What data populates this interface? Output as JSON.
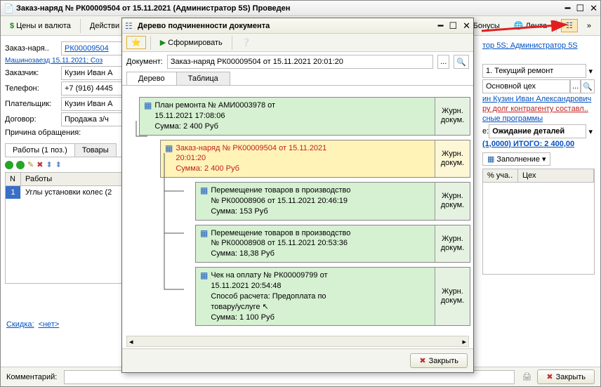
{
  "main_window": {
    "title": "Заказ-наряд № РК00009504 от 15.11.2021 (Администратор 5S) Проведен",
    "toolbar": {
      "prices": "Цены и валюта",
      "actions": "Действи",
      "bonuses": "Бонусы",
      "lenta": "Лента"
    },
    "link_top": "Машинозаезд 15.11.2021; Соз",
    "fields": {
      "order_label": "Заказ-наря..",
      "order_value": "РК00009504",
      "customer_label": "Заказчик:",
      "customer_value": "Кузин Иван А",
      "phone_label": "Телефон:",
      "phone_value": "+7 (916) 4445",
      "payer_label": "Плательщик:",
      "payer_value": "Кузин Иван А",
      "contract_label": "Договор:",
      "contract_value": "Продажа з/ч",
      "reason_label": "Причина обращения:"
    },
    "tabs": {
      "works": "Работы (1 поз.)",
      "goods": "Товары"
    },
    "table": {
      "col_n": "N",
      "col_work": "Работы",
      "row_n": "1",
      "row_work": "Углы установки колес (2"
    },
    "discount": {
      "label": "Скидка:",
      "value": "<нет>"
    },
    "comment_label": "Комментарий:",
    "close_btn": "Закрыть",
    "right": {
      "admin": "тор 5S; Администратор 5S",
      "repair_type": "1. Текущий ремонт",
      "workshop": "Основной цех",
      "owner": "ин Кузин Иван Александрович",
      "debt": "ру долг контрагенту составл..",
      "programs": "сные программы",
      "state_lbl": "е:",
      "state": "Ожидание деталей",
      "total": "(1,0000) ИТОГО: 2 400,00",
      "fill_btn": "Заполнение",
      "col_pct": "% уча..",
      "col_shop": "Цех"
    }
  },
  "modal": {
    "title": "Дерево подчиненности документа",
    "form_btn": "Сформировать",
    "doc_label": "Документ:",
    "doc_value": "Заказ-наряд РК00009504 от 15.11.2021 20:01:20",
    "tab_tree": "Дерево",
    "tab_table": "Таблица",
    "journ": "Журн. докум.",
    "close_btn": "Закрыть",
    "nodes": {
      "n1": {
        "l1": "План ремонта № АМИ0003978 от",
        "l2": "15.11.2021 17:08:06",
        "l3": "Сумма: 2 400 Руб"
      },
      "n2": {
        "l1": "Заказ-наряд № РК00009504 от 15.11.2021",
        "l2": "20:01:20",
        "l3": "Сумма: 2 400 Руб"
      },
      "n3": {
        "l1": "Перемещение товаров в производство",
        "l2": "№ РК00008906 от 15.11.2021 20:46:19",
        "l3": "Сумма: 153 Руб"
      },
      "n4": {
        "l1": "Перемещение товаров в производство",
        "l2": "№ РК00008908 от 15.11.2021 20:53:36",
        "l3": "Сумма: 18,38 Руб"
      },
      "n5": {
        "l1": "Чек на оплату № РК00009799 от",
        "l2": "15.11.2021 20:54:48",
        "l3": "Способ расчета: Предоплата по",
        "l4": "товару/услуге",
        "l5": "Сумма: 1 100 Руб"
      }
    }
  }
}
